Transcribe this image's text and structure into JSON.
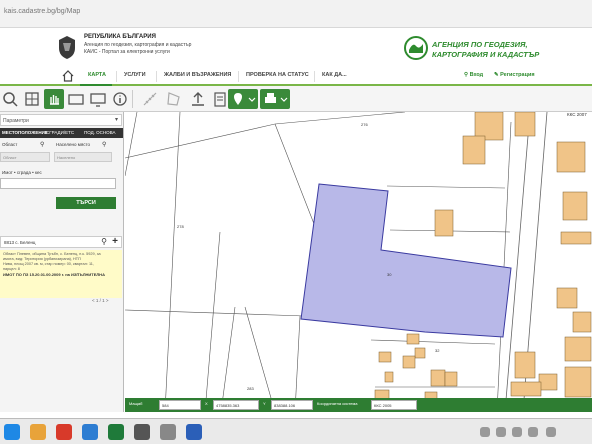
{
  "browser": {
    "url": "kais.cadastre.bg/bg/Map"
  },
  "header": {
    "gov_title": "РЕПУБЛИКА БЪЛГАРИЯ",
    "gov_lines": [
      "Агенция по геодезия, картография и кадастър",
      "КАИС - Портал за електронни услуги"
    ],
    "agency_lines": [
      "АГЕНЦИЯ ПО ГЕОДЕЗИЯ,",
      "КАРТОГРАФИЯ И КАДАСТЪР"
    ],
    "brand_color": "#2e8b2e"
  },
  "nav": {
    "items": [
      "КАРТА",
      "УСЛУГИ",
      "ЖАЛБИ И ВЪЗРАЖЕНИЯ",
      "ПРОВЕРКА НА СТАТУС",
      "КАК ДА..."
    ],
    "active": "КАРТА",
    "login": "Вход",
    "register": "Регистрация"
  },
  "toolbar": {
    "icons": [
      "zoom-icon",
      "zoom-extent-icon",
      "pan-icon",
      "layers-icon",
      "screen-icon",
      "info-icon",
      "measure-icon",
      "area-icon",
      "upload-icon",
      "clear-icon",
      "location-icon",
      "print-icon"
    ]
  },
  "sidebar": {
    "filter_select": "Параметри",
    "tabs": [
      "МЕСТОПОЛОЖЕНИЕ",
      "СГРАДИ/ЕТС",
      "ПОД. ОСНОВА"
    ],
    "label_area": "Област",
    "label_place": "Населено място",
    "combo_area": "Област",
    "combo_place": "Населено",
    "label_id": "Имот • сграда • кес",
    "search_button": "ТЪРСИ",
    "result_title": "8813 с. Беленц",
    "result_lines": [
      "Област Плевен, община Тръбн, с. Беленц, п.к. 5929, за",
      "имота, вид: Територия (урбанизирана), НТП",
      "Нива, площ 2007 кв. м, стар номер: 00, квартал: 11,",
      "парцел: 8"
    ],
    "result_highlight": "ИМОТ ПО ПЗ 15.20.01.00.2009 г. на ИЗПЪЛНИТЕЛНА",
    "pager": "< 1 / 1 >"
  },
  "map": {
    "parcel_labels": [
      "276",
      "278",
      "30",
      "32",
      "283"
    ],
    "kks_label": "ККС 2007",
    "highlight_color": "#b8b8e8",
    "building_color": "#f0c488"
  },
  "coordbar": {
    "label_scale": "Мащаб",
    "scale_value": "584",
    "label_x": "X",
    "x_value": "4758835.363",
    "label_y": "Y",
    "y_value": "838388.106",
    "label_system": "Координатна система",
    "system_value": "ККС 2005"
  }
}
